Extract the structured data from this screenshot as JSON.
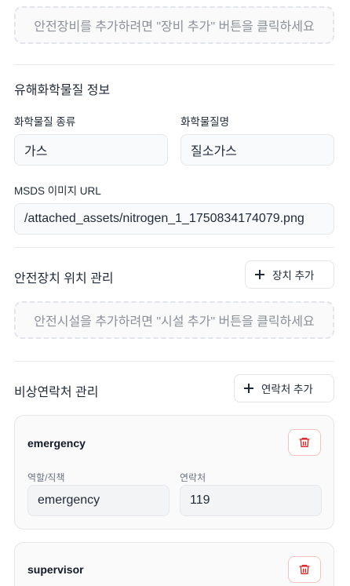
{
  "equipment": {
    "empty_text": "안전장비를 추가하려면 \"장비 추가\" 버튼을 클릭하세요"
  },
  "chemical": {
    "section_title": "유해화학물질 정보",
    "type_label": "화학물질 종류",
    "type_value": "가스",
    "name_label": "화학물질명",
    "name_value": "질소가스",
    "msds_label": "MSDS 이미지 URL",
    "msds_value": "/attached_assets/nitrogen_1_1750834174079.png"
  },
  "device_location": {
    "section_title": "안전장치 위치 관리",
    "add_label": "장치 추가",
    "empty_text": "안전시설을 추가하려면 \"시설 추가\" 버튼을 클릭하세요"
  },
  "emergency_contacts": {
    "section_title": "비상연락처 관리",
    "add_label": "연락처 추가",
    "role_label": "역할/직책",
    "contact_label": "연락처",
    "items": [
      {
        "name": "emergency",
        "role": "emergency",
        "contact": "119"
      },
      {
        "name": "supervisor"
      }
    ]
  },
  "icons": {
    "add": "plus-icon",
    "delete": "trash-icon"
  },
  "colors": {
    "delete_accent": "#dc2626",
    "dashed_border": "#e2e5ea"
  }
}
